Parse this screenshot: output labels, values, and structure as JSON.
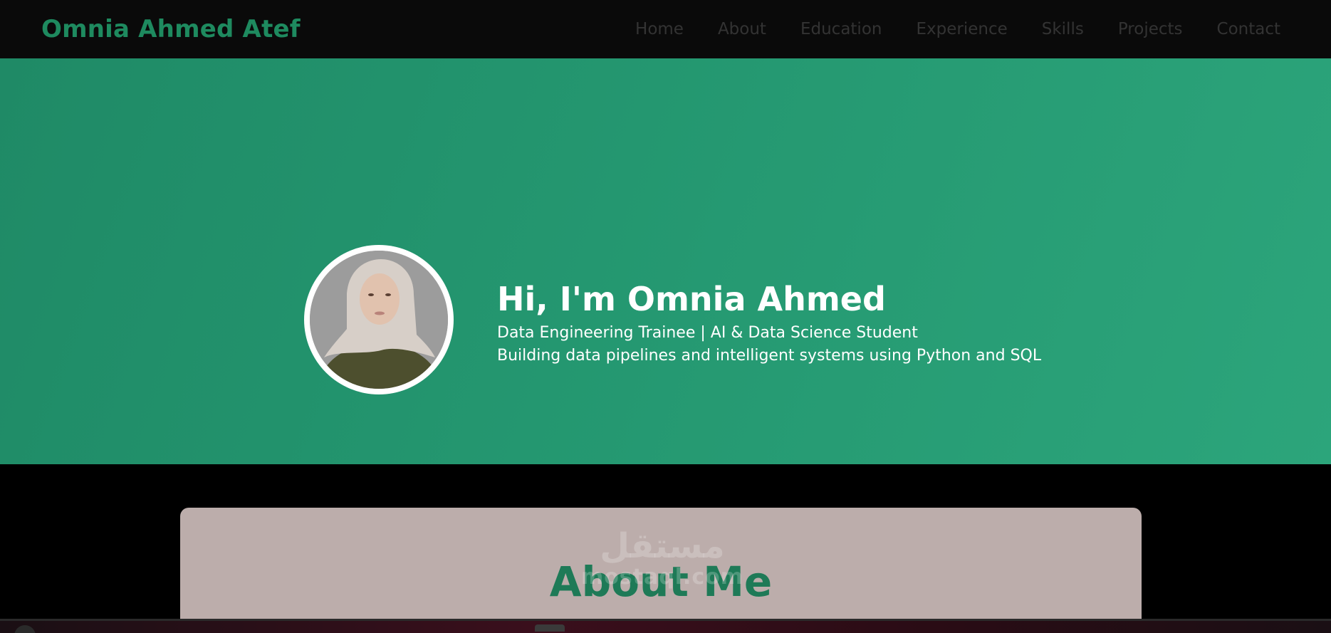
{
  "navbar": {
    "brand": "Omnia Ahmed Atef",
    "links": [
      "Home",
      "About",
      "Education",
      "Experience",
      "Skills",
      "Projects",
      "Contact"
    ]
  },
  "hero": {
    "title": "Hi, I'm Omnia Ahmed",
    "subtitle": "Data Engineering Trainee | AI & Data Science Student",
    "description": "Building data pipelines and intelligent systems using Python and SQL"
  },
  "about": {
    "title": "About Me"
  },
  "watermark": {
    "arabic": "مستقل",
    "english": "mostaql.com"
  },
  "colors": {
    "brand": "#1e8a5f",
    "hero_bg": "#249770",
    "about_card_bg": "#bcadab",
    "about_title": "#1e7a57"
  }
}
